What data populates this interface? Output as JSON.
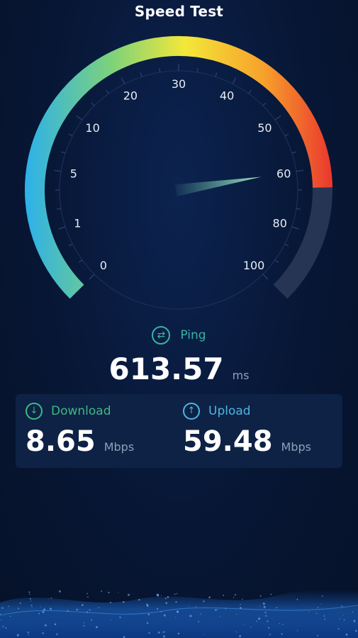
{
  "title": "Speed Test",
  "gauge": {
    "ticks": [
      "0",
      "1",
      "5",
      "10",
      "20",
      "30",
      "40",
      "50",
      "60",
      "80",
      "100"
    ],
    "needle_value": 60,
    "gradient_colors": [
      "#2fb2e6",
      "#7fd27a",
      "#f3e839",
      "#f7a12b",
      "#ea3b2e"
    ],
    "track_color": "#253553",
    "needle_color": "#7ee3b9"
  },
  "ping": {
    "label": "Ping",
    "value": "613.57",
    "unit": "ms",
    "icon": "swap-arrows-icon"
  },
  "download": {
    "label": "Download",
    "value": "8.65",
    "unit": "Mbps",
    "icon": "arrow-down-circle-icon"
  },
  "upload": {
    "label": "Upload",
    "value": "59.48",
    "unit": "Mbps",
    "icon": "arrow-up-circle-icon"
  }
}
